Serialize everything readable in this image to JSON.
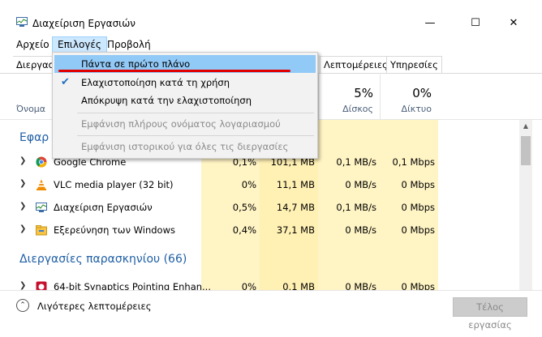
{
  "window": {
    "title": "Διαχείριση Εργασιών",
    "minimize_glyph": "—",
    "maximize_glyph": "☐",
    "close_glyph": "✕"
  },
  "menubar": {
    "items": [
      "Αρχείο",
      "Επιλογές",
      "Προβολή"
    ]
  },
  "tabs": {
    "partial_first": "Διεργασ",
    "visible": [
      "Λεπτομέρειες",
      "Υπηρεσίες"
    ]
  },
  "header": {
    "name_col": "Όνομα",
    "columns": [
      {
        "pct": "",
        "label": ""
      },
      {
        "pct": "",
        "label": ""
      },
      {
        "pct": "5%",
        "label": "Δίσκος"
      },
      {
        "pct": "0%",
        "label": "Δίκτυο"
      }
    ]
  },
  "groups": {
    "apps_partial": "Εφαρ",
    "background": "Διεργασίες παρασκηνίου (66)"
  },
  "rows": [
    {
      "name": "Google Chrome",
      "cpu": "0,1%",
      "mem": "101,1 MB",
      "disk": "0,1 MB/s",
      "net": "0,1 Mbps",
      "icon": "chrome-icon"
    },
    {
      "name": "VLC media player (32 bit)",
      "cpu": "0%",
      "mem": "11,1 MB",
      "disk": "0 MB/s",
      "net": "0 Mbps",
      "icon": "vlc-icon"
    },
    {
      "name": "Διαχείριση Εργασιών",
      "cpu": "0,5%",
      "mem": "14,7 MB",
      "disk": "0,1 MB/s",
      "net": "0 Mbps",
      "icon": "task-manager-icon"
    },
    {
      "name": "Εξερεύνηση των Windows",
      "cpu": "0,4%",
      "mem": "37,1 MB",
      "disk": "0 MB/s",
      "net": "0 Mbps",
      "icon": "explorer-icon"
    }
  ],
  "bg_row": {
    "name": "64-bit Synaptics Pointing Enhan...",
    "cpu": "0%",
    "mem": "0,1 MB",
    "disk": "0 MB/s",
    "net": "0 Mbps",
    "icon": "synaptics-icon"
  },
  "footer": {
    "less_details": "Λιγότερες λεπτομέρειες",
    "end_task": "Τέλος εργασίας"
  },
  "dropdown": {
    "items": [
      {
        "label": "Πάντα σε πρώτο πλάνο",
        "checked": false,
        "disabled": false,
        "highlighted": true
      },
      {
        "label": "Ελαχιστοποίηση κατά τη χρήση",
        "checked": true,
        "disabled": false,
        "highlighted": false
      },
      {
        "label": "Απόκρυψη κατά την ελαχιστοποίηση",
        "checked": false,
        "disabled": false,
        "highlighted": false
      },
      {
        "label": "Εμφάνιση πλήρους ονόματος λογαριασμού",
        "checked": false,
        "disabled": true,
        "highlighted": false
      },
      {
        "label": "Εμφάνιση ιστορικού για όλες τις διεργασίες",
        "checked": false,
        "disabled": true,
        "highlighted": false
      }
    ],
    "check_glyph": "✔"
  },
  "colors": {
    "accent": "#1f5fa6",
    "heat": "#fff4c4",
    "menu_highlight": "#91c9f7",
    "annotation": "#e00000"
  }
}
